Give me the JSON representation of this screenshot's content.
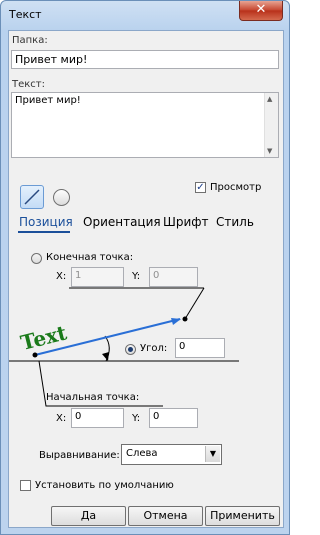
{
  "window": {
    "title": "Текст",
    "close_symbol": "✕"
  },
  "folder": {
    "label": "Папка:",
    "value": "Привет мир!"
  },
  "text": {
    "label": "Текст:",
    "value": "Привет мир!"
  },
  "preview": {
    "label": "Просмотр",
    "checked": true
  },
  "tabs": [
    {
      "label": "Позиция",
      "active": true
    },
    {
      "label": "Ориентация",
      "active": false
    },
    {
      "label": "Шрифт",
      "active": false
    },
    {
      "label": "Стиль",
      "active": false
    }
  ],
  "end_point": {
    "label": "Конечная точка:",
    "x_label": "X:",
    "x_value": "1",
    "y_label": "Y:",
    "y_value": "0"
  },
  "angle": {
    "label": "Угол:",
    "value": "0"
  },
  "diagram": {
    "sample_text": "Text"
  },
  "start_point": {
    "label": "Начальная точка:",
    "x_label": "X:",
    "x_value": "0",
    "y_label": "Y:",
    "y_value": "0"
  },
  "alignment": {
    "label": "Выравнивание:",
    "value": "Слева"
  },
  "default_checkbox": {
    "label": "Установить по умолчанию",
    "checked": false
  },
  "buttons": {
    "ok": "Да",
    "cancel": "Отмена",
    "apply": "Применить"
  },
  "colors": {
    "accent_tab": "#1b4f9a",
    "sample_text": "#1a7a1a",
    "arrow": "#2a6fd6"
  }
}
